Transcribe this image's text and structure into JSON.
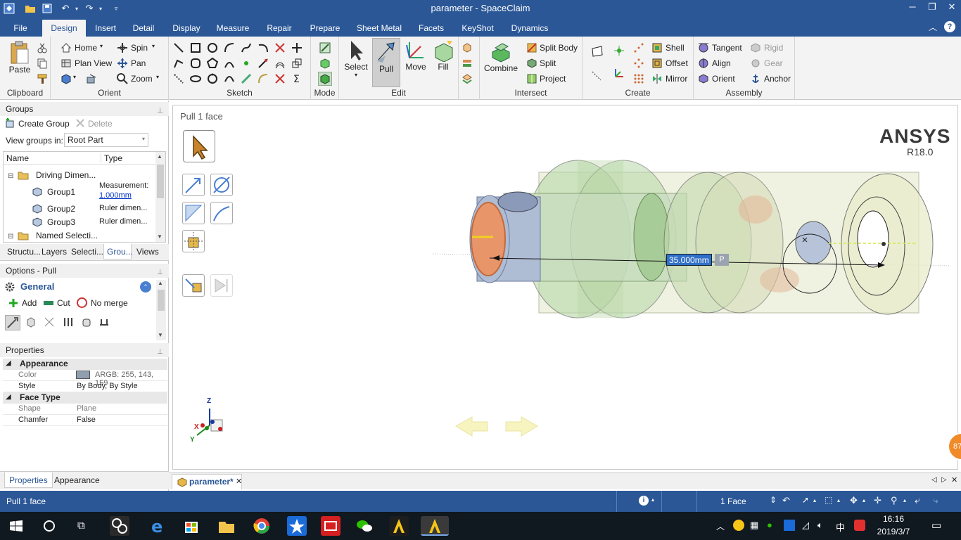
{
  "window": {
    "title": "parameter - SpaceClaim"
  },
  "tabs": [
    "File",
    "Design",
    "Insert",
    "Detail",
    "Display",
    "Measure",
    "Repair",
    "Prepare",
    "Sheet Metal",
    "Facets",
    "KeyShot",
    "Dynamics"
  ],
  "active_tab": "Design",
  "ribbon": {
    "clipboard": {
      "label": "Clipboard",
      "paste": "Paste"
    },
    "orient": {
      "label": "Orient",
      "home": "Home",
      "plan_view": "Plan View",
      "spin": "Spin",
      "pan": "Pan",
      "zoom": "Zoom"
    },
    "sketch": {
      "label": "Sketch"
    },
    "mode": {
      "label": "Mode"
    },
    "edit": {
      "label": "Edit",
      "select": "Select",
      "pull": "Pull",
      "move": "Move",
      "fill": "Fill"
    },
    "intersect": {
      "label": "Intersect",
      "combine": "Combine",
      "split_body": "Split Body",
      "split": "Split",
      "project": "Project"
    },
    "create": {
      "label": "Create",
      "shell": "Shell",
      "offset": "Offset",
      "mirror": "Mirror"
    },
    "assembly": {
      "label": "Assembly",
      "tangent": "Tangent",
      "align": "Align",
      "orient": "Orient",
      "rigid": "Rigid",
      "gear": "Gear",
      "anchor": "Anchor"
    }
  },
  "groups_panel": {
    "title": "Groups",
    "create_group": "Create Group",
    "delete": "Delete",
    "view_groups_label": "View groups in:",
    "view_groups_value": "Root Part",
    "col_name": "Name",
    "col_type": "Type",
    "rows": [
      {
        "name": "Driving Dimen...",
        "type": ""
      },
      {
        "name": "Group1",
        "type": "Measurement:",
        "type2": "1.000mm"
      },
      {
        "name": "Group2",
        "type": "Ruler dimen..."
      },
      {
        "name": "Group3",
        "type": "Ruler dimen..."
      },
      {
        "name": "Named Selecti...",
        "type": ""
      }
    ],
    "bottom_tabs": [
      "Structu...",
      "Layers",
      "Selecti...",
      "Grou...",
      "Views"
    ]
  },
  "options_panel": {
    "title": "Options - Pull",
    "section": "General",
    "add": "Add",
    "cut": "Cut",
    "no_merge": "No merge"
  },
  "properties_panel": {
    "title": "Properties",
    "appearance": "Appearance",
    "color_label": "Color",
    "color_value": "ARGB: 255, 143, 159",
    "style_label": "Style",
    "style_value": "By Body, By Style",
    "face_type": "Face Type",
    "shape_label": "Shape",
    "shape_value": "Plane",
    "chamfer_label": "Chamfer",
    "chamfer_value": "False",
    "bottom_tabs": [
      "Properties",
      "Appearance"
    ]
  },
  "viewport": {
    "title": "Pull 1 face",
    "brand": "ANSYS",
    "version": "R18.0",
    "dimension": "35.000mm",
    "dim_suffix": "P",
    "axis_z": "Z",
    "axis_x": "X",
    "axis_y": "Y",
    "badge": "87"
  },
  "doc_tab": "parameter*",
  "status": {
    "left": "Pull 1 face",
    "selection": "1 Face"
  },
  "taskbar": {
    "time": "16:16",
    "date": "2019/3/7",
    "ime": "中"
  },
  "colors": {
    "titlebar": "#2b5797",
    "ribbon": "#f3f3f3",
    "taskbar": "#101820",
    "accent": "#2b5797",
    "selected_face": "#e8956a"
  }
}
